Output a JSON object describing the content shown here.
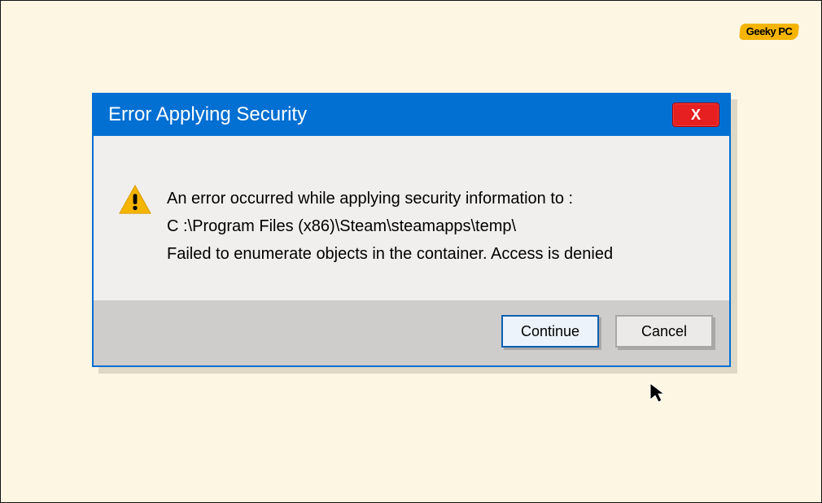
{
  "logo": {
    "text": "Geeky PC"
  },
  "dialog": {
    "title": "Error Applying Security",
    "close_glyph": "X",
    "message": {
      "line1": "An error occurred while applying security information to :",
      "line2": "C :\\Program Files (x86)\\Steam\\steamapps\\temp\\",
      "line3": "Failed to enumerate objects in the container. Access is denied"
    },
    "buttons": {
      "continue_label": "Continue",
      "cancel_label": "Cancel"
    }
  }
}
